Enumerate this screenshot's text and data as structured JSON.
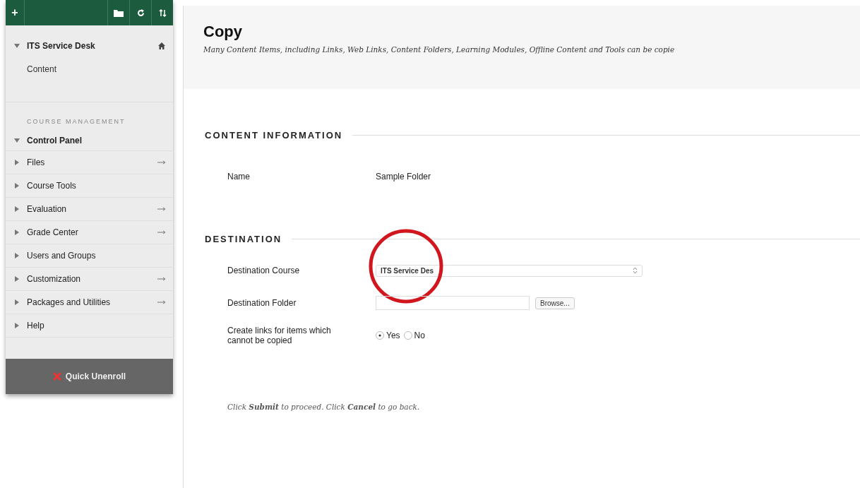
{
  "sidebar": {
    "toolbar": {
      "add": "+"
    },
    "course": {
      "title": "ITS Service Desk",
      "expanded": true,
      "items": [
        "Content"
      ]
    },
    "section_heading": "COURSE MANAGEMENT",
    "panel": {
      "title": "Control Panel",
      "expanded": true,
      "items": [
        {
          "label": "Files",
          "expanded": false,
          "quick_link": true
        },
        {
          "label": "Course Tools",
          "expanded": false,
          "quick_link": false
        },
        {
          "label": "Evaluation",
          "expanded": false,
          "quick_link": true
        },
        {
          "label": "Grade Center",
          "expanded": false,
          "quick_link": true
        },
        {
          "label": "Users and Groups",
          "expanded": false,
          "quick_link": false
        },
        {
          "label": "Customization",
          "expanded": false,
          "quick_link": true
        },
        {
          "label": "Packages and Utilities",
          "expanded": false,
          "quick_link": true
        },
        {
          "label": "Help",
          "expanded": false,
          "quick_link": false
        }
      ]
    },
    "footer_button": "Quick Unenroll"
  },
  "page": {
    "title": "Copy",
    "description": "Many Content Items, including Links, Web Links, Content Folders, Learning Modules, Offline Content and Tools can be copie",
    "sections": [
      {
        "heading": "CONTENT INFORMATION",
        "fields": [
          {
            "kind": "text",
            "label": "Name",
            "value": "Sample Folder"
          }
        ]
      },
      {
        "heading": "DESTINATION",
        "fields": [
          {
            "kind": "select",
            "label": "Destination Course",
            "value": "ITS Service Des",
            "annotated": true
          },
          {
            "kind": "browse",
            "label": "Destination Folder",
            "button": "Browse..."
          },
          {
            "kind": "radio",
            "label": "Create links for items which cannot be copied",
            "options": [
              {
                "label": "Yes",
                "selected": true
              },
              {
                "label": "No",
                "selected": false
              }
            ]
          }
        ]
      }
    ],
    "footer": "Click **Submit** to proceed. Click **Cancel** to go back."
  }
}
